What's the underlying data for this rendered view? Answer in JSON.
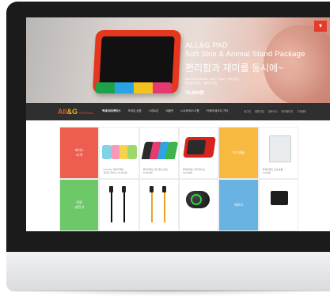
{
  "hero": {
    "title_line1": "ALL&G PAD",
    "title_line2": "Soft Skin & Animal Stand Package",
    "subtitle": "편리함과 재미를 동시에~",
    "description": "Slot One Plus Skin Case / Stand · 완벽 호환 / 유아용 디자인 · 풍부한 색상",
    "price": "35,800원",
    "menu_icon": "chevron-down-icon"
  },
  "nav": {
    "logo_main_1": "All",
    "logo_amp": "&",
    "logo_main_2": "G",
    "logo_suffix": "OFFICIAL",
    "items": [
      "액세서리/케이스",
      "모바일 상품",
      "스마트폰",
      "태블릿",
      "노트북/데스크톱",
      "카메라/캠코더 기타"
    ],
    "utilities": [
      "로그인",
      "회원가입",
      "장바구니",
      "마이페이지",
      "고객센터"
    ]
  },
  "grid": {
    "categories": {
      "red": "케이스\n/가죽",
      "yellow": "보호필름",
      "green": "전원\n/충전기",
      "blue": "메모리"
    },
    "products": [
      "Soft Skin 올앤지패드\n실리콘 케이스 35,800원",
      "올앤지패드 애니멀 스탠드\n35,800원",
      "올앤지패드 레더케이스\n29,000원",
      "올앤지패드 보호필름\n9,000원"
    ],
    "colors": {
      "red": "#ee5e50",
      "yellow": "#f8b941",
      "green": "#6dc86a",
      "blue": "#68b3e2"
    }
  }
}
